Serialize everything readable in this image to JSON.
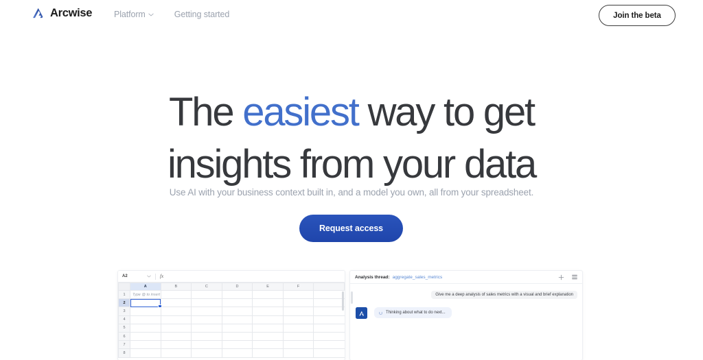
{
  "brand": {
    "name": "Arcwise",
    "logo_icon": "arcwise-logo-icon"
  },
  "nav": {
    "links": [
      {
        "label": "Platform",
        "has_dropdown": true,
        "icon": "chevron-down-icon"
      },
      {
        "label": "Getting started",
        "has_dropdown": false
      }
    ],
    "cta_label": "Join the beta"
  },
  "hero": {
    "headline_part1": "The ",
    "headline_highlight": "easiest",
    "headline_part2": " way to get",
    "headline_line2": "insights from your data",
    "subhead": "Use AI with your business context built in, and a model you own, all from your spreadsheet.",
    "cta_label": "Request access",
    "highlight_color": "#4270cb",
    "cta_color": "#1f45ab"
  },
  "product": {
    "spreadsheet": {
      "cell_reference": "A2",
      "dropdown_icon": "chevron-down-icon",
      "formula_icon": "fx-icon",
      "formula_value": "",
      "columns": [
        "A",
        "B",
        "C",
        "D",
        "E",
        "F"
      ],
      "selected_column": "A",
      "rows": [
        "1",
        "2",
        "3",
        "4",
        "5",
        "6",
        "7",
        "8"
      ],
      "selected_row": "2",
      "cell_a1_placeholder": "Type @ to insert",
      "active_cell": "A2"
    },
    "thread": {
      "title": "Analysis thread:",
      "file_name": "aggregate_sales_metrics",
      "add_icon": "plus-icon",
      "menu_icon": "hamburger-menu-icon",
      "user_message": "Give me a deep analysis of sales metrics with a visual and brief explanation",
      "assistant_avatar_icon": "arcwise-avatar-icon",
      "assistant_status": "Thinking about what to do next...",
      "spinner_icon": "loading-spinner-icon"
    }
  }
}
